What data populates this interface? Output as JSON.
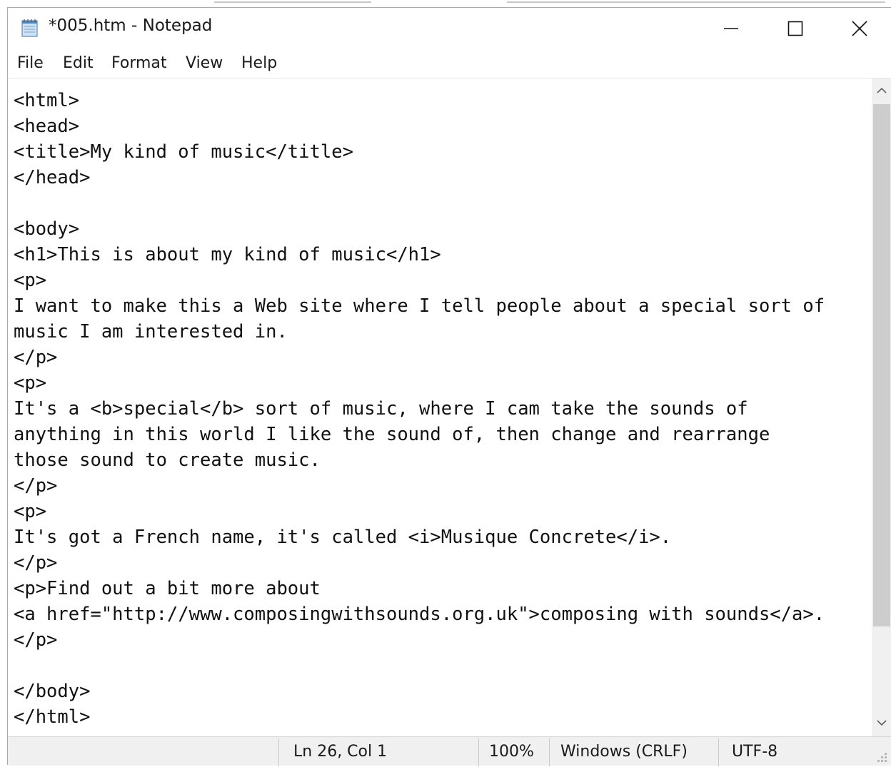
{
  "window": {
    "title": "*005.htm - Notepad",
    "icon": "notepad-icon"
  },
  "menu": [
    "File",
    "Edit",
    "Format",
    "View",
    "Help"
  ],
  "editor": {
    "lines": [
      "<html>",
      "<head>",
      "<title>My kind of music</title>",
      "</head>",
      "",
      "<body>",
      "<h1>This is about my kind of music</h1>",
      "<p>",
      "I want to make this a Web site where I tell people about a special sort of",
      "music I am interested in.",
      "</p>",
      "<p>",
      "It's a <b>special</b> sort of music, where I cam take the sounds of",
      "anything in this world I like the sound of, then change and rearrange",
      "those sound to create music.",
      "</p>",
      "<p>",
      "It's got a French name, it's called <i>Musique Concrete</i>.",
      "</p>",
      "<p>Find out a bit more about",
      "<a href=\"http://www.composingwithsounds.org.uk\">composing with sounds</a>.",
      "</p>",
      "",
      "</body>",
      "</html>"
    ]
  },
  "status": {
    "position": "Ln 26, Col 1",
    "zoom": "100%",
    "line_endings": "Windows (CRLF)",
    "encoding": "UTF-8"
  },
  "colors": {
    "text": "#111111",
    "status_bg": "#f0f0f0",
    "scroll_thumb": "#cdcdcd"
  }
}
